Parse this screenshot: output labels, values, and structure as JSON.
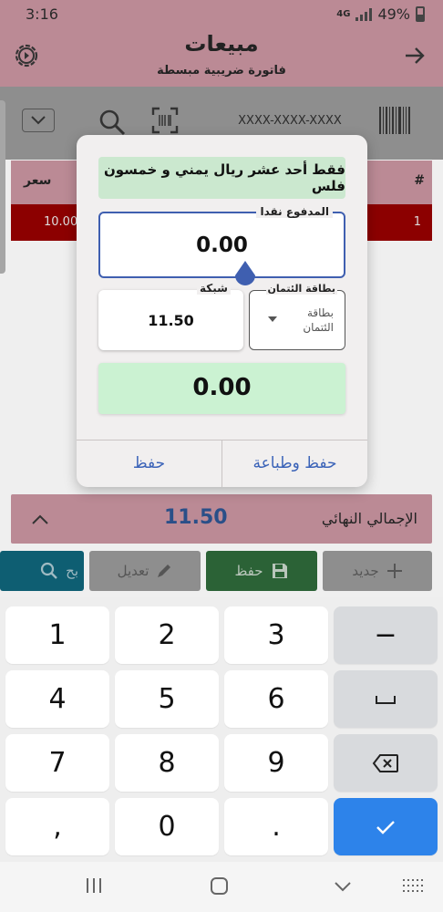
{
  "status_bar": {
    "time": "3:16",
    "network": "4G",
    "battery": "49%"
  },
  "app_bar": {
    "title": "مبيعات",
    "subtitle": "فاتورة ضريبية مبسطة"
  },
  "search_row": {
    "code_placeholder": "XXXX-XXXX-XXXX"
  },
  "table": {
    "header_hash": "#",
    "header_price": "سعر",
    "row_index": "1",
    "row_price": "10.00"
  },
  "total_bar": {
    "label": "الإجمالي النهائي",
    "amount": "11.50"
  },
  "actions": {
    "new": "جديد",
    "save": "حفظ",
    "edit": "تعديل",
    "search": "بح"
  },
  "dialog": {
    "amount_in_words": "فقط أحد عشر ريال يمني و خمسون فلس",
    "cash_label": "المدفوع نقدا",
    "cash_value": "0.00",
    "network_label": "شبكة",
    "network_value": "11.50",
    "card_label": "بطاقة الئتمان",
    "card_value": "بطاقة الئتمان",
    "change_value": "0.00",
    "save_print_label": "حفظ وطباعة",
    "save_label": "حفظ"
  },
  "keyboard": {
    "rows": [
      [
        "1",
        "2",
        "3",
        "−"
      ],
      [
        "4",
        "5",
        "6",
        "␣"
      ],
      [
        "7",
        "8",
        "9",
        "⌫"
      ],
      [
        ",",
        "0",
        ".",
        "✓"
      ]
    ]
  },
  "colors": {
    "accent": "#3f5fb0",
    "done_key": "#2d83ea",
    "header": "#bb8a95",
    "green_box": "#cbf2d2"
  }
}
